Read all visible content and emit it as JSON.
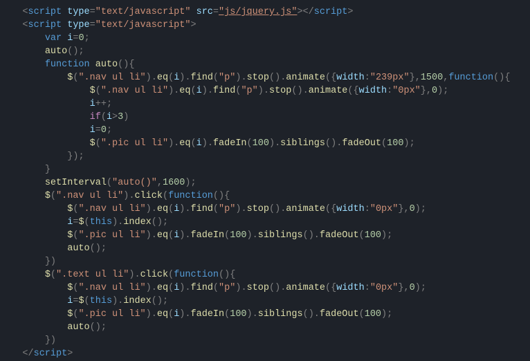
{
  "code": {
    "tag_script": "script",
    "attr_type": "type",
    "attr_src": "src",
    "val_js": "\"text/javascript\"",
    "val_src": "\"js/jquery.js\"",
    "kw_var": "var",
    "kw_function": "function",
    "kw_if": "if",
    "kw_this": "this",
    "id_i": "i",
    "id_auto": "auto",
    "fn_auto": "auto",
    "fn_$": "$",
    "fn_eq": "eq",
    "fn_find": "find",
    "fn_stop": "stop",
    "fn_animate": "animate",
    "fn_fadeIn": "fadeIn",
    "fn_siblings": "siblings",
    "fn_fadeOut": "fadeOut",
    "fn_setInterval": "setInterval",
    "fn_click": "click",
    "fn_index": "index",
    "id_width": "width",
    "str_nav": "\".nav ul li\"",
    "str_pic": "\".pic ul li\"",
    "str_text": "\".text ul li\"",
    "str_p": "\"p\"",
    "str_239": "\"239px\"",
    "str_0px": "\"0px\"",
    "str_autocall": "\"auto()\"",
    "n_0": "0",
    "n_3": "3",
    "n_100": "100",
    "n_1500": "1500",
    "n_1600": "1600",
    "op_eq": "=",
    "op_pp": "++",
    "op_gt": ">",
    "sc": ";",
    "lp": "(",
    "rp": ")",
    "lb": "{",
    "rb": "}",
    "dot": ".",
    "com": ",",
    "lt": "<",
    "gt_p": ">",
    "lts": "</",
    "col": ":"
  }
}
